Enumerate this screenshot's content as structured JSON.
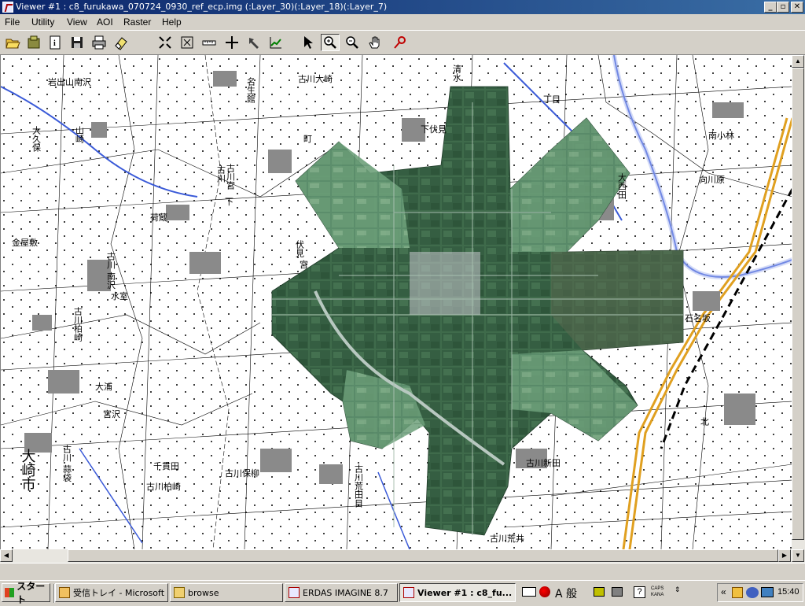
{
  "window": {
    "title": "Viewer #1 : c8_furukawa_070724_0930_ref_ecp.img (:Layer_30)(:Layer_18)(:Layer_7)"
  },
  "menu": [
    "File",
    "Utility",
    "View",
    "AOI",
    "Raster",
    "Help"
  ],
  "toolbar": [
    {
      "name": "open-icon"
    },
    {
      "name": "close-layer-icon"
    },
    {
      "name": "info-icon"
    },
    {
      "name": "save-icon"
    },
    {
      "name": "print-icon"
    },
    {
      "name": "erase-icon"
    },
    {
      "name": "zoom-fit-icon"
    },
    {
      "name": "fit-window-icon"
    },
    {
      "name": "measure-icon"
    },
    {
      "name": "inquire-cursor-icon"
    },
    {
      "name": "hammer-icon"
    },
    {
      "name": "profile-icon"
    },
    {
      "name": "select-arrow-icon"
    },
    {
      "name": "zoom-in-icon"
    },
    {
      "name": "zoom-out-icon"
    },
    {
      "name": "pan-hand-icon"
    },
    {
      "name": "roam-icon"
    }
  ],
  "map_labels": [
    "岩出山南沢",
    "名生館",
    "古川大崎",
    "清水",
    "下伏見",
    "丁目",
    "大久保",
    "山崎",
    "古川",
    "町",
    "古川宮",
    "下",
    "荷蔵",
    "金屋敷",
    "伏見",
    "宮",
    "南小林",
    "向川原",
    "古川 南沢",
    "水室",
    "古川柏崎",
    "大浦",
    "宮沢",
    "大崎市",
    "古川 蒜袋",
    "千貫田",
    "古川柏崎",
    "古川保柳",
    "古川荒田目",
    "古川新田",
    "古川荒井",
    "石名坂",
    "北",
    "大西田"
  ],
  "taskbar": {
    "start_label": "スタート",
    "items": [
      {
        "label": "受信トレイ - Microsoft ..."
      },
      {
        "label": "browse"
      },
      {
        "label": "ERDAS IMAGINE 8.7"
      },
      {
        "label": "Viewer #1 : c8_fu..."
      }
    ],
    "ime_label": "A 般",
    "caps_label": "CAPS KANA",
    "clock": "15:40"
  },
  "colors": {
    "titlebar_start": "#0a246a",
    "titlebar_end": "#3a6ea5",
    "chrome": "#d4d0c8",
    "map_bg": "#ffffff",
    "river": "#3a5ad8",
    "highway": "#e0a020",
    "ortho_dark": "#2f5a3c",
    "ortho_light": "#6a9a70"
  }
}
